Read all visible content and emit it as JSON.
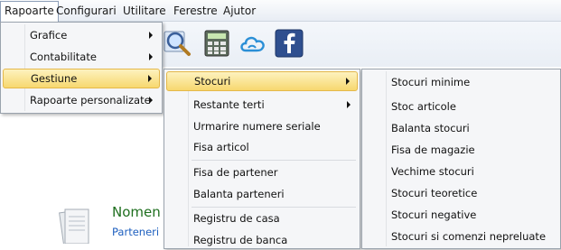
{
  "menubar": {
    "items": [
      "Rapoarte",
      "Configurari",
      "Utilitare",
      "Ferestre",
      "Ajutor"
    ],
    "active": "Rapoarte"
  },
  "toolbar": {
    "icons": [
      "search-icon",
      "calculator-icon",
      "cloud-icon",
      "facebook-icon"
    ]
  },
  "menu_rapoarte": {
    "items": [
      {
        "label": "Grafice",
        "submenu": true
      },
      {
        "label": "Contabilitate",
        "submenu": true
      },
      {
        "label": "Gestiune",
        "submenu": true,
        "selected": true
      },
      {
        "label": "Rapoarte personalizate",
        "submenu": true
      }
    ]
  },
  "menu_gestiune": {
    "items": [
      {
        "label": "Stocuri",
        "submenu": true,
        "selected": true
      },
      {
        "label": "Restante terti",
        "submenu": true
      },
      {
        "label": "Urmarire numere seriale"
      },
      {
        "label": "Fisa articol"
      },
      {
        "label": "Fisa de partener"
      },
      {
        "label": "Balanta parteneri"
      },
      {
        "label": "Registru de casa"
      },
      {
        "label": "Registru de banca"
      }
    ]
  },
  "menu_stocuri": {
    "items": [
      {
        "label": "Stocuri minime"
      },
      {
        "label": "Stoc articole"
      },
      {
        "label": "Balanta stocuri"
      },
      {
        "label": "Fisa de magazie"
      },
      {
        "label": "Vechime stocuri"
      },
      {
        "label": "Stocuri teoretice"
      },
      {
        "label": "Stocuri negative"
      },
      {
        "label": "Stocuri si comenzi nepreluate"
      }
    ]
  },
  "main": {
    "heading": "Nomen",
    "link": "Parteneri"
  },
  "colors": {
    "highlight": "#f7d86f",
    "heading": "#1f6f1f",
    "link": "#1d5fbf"
  }
}
